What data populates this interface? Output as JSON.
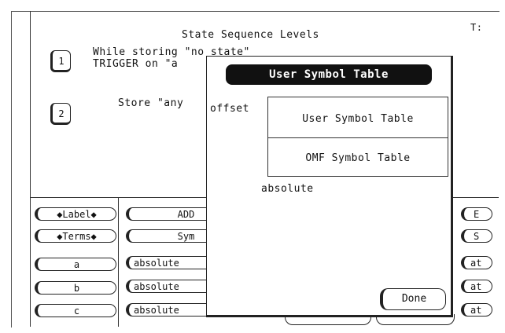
{
  "header": {
    "title": "State Sequence Levels",
    "corner_text": "T:"
  },
  "levels": [
    {
      "number": "1",
      "line1": "While storing \"no state\"",
      "line2": "TRIGGER on \"a"
    },
    {
      "number": "2",
      "line1": "Store \"any"
    }
  ],
  "rows": {
    "label_btn": "◆Label◆",
    "terms_btn": "◆Terms◆",
    "row_names": [
      "a",
      "b",
      "c"
    ],
    "col1_header": "ADD",
    "col1_sub": "Sym",
    "col1_values": [
      "absolute",
      "absolute",
      "absolute"
    ],
    "right_header": "E",
    "right_sub": "S",
    "right_values": [
      "at",
      "at",
      "at"
    ]
  },
  "popup": {
    "title": "User Symbol Table",
    "offset_label": "offset",
    "menu_items": [
      "User Symbol Table",
      "OMF Symbol Table"
    ],
    "absolute_text": "absolute",
    "done_label": "Done"
  }
}
